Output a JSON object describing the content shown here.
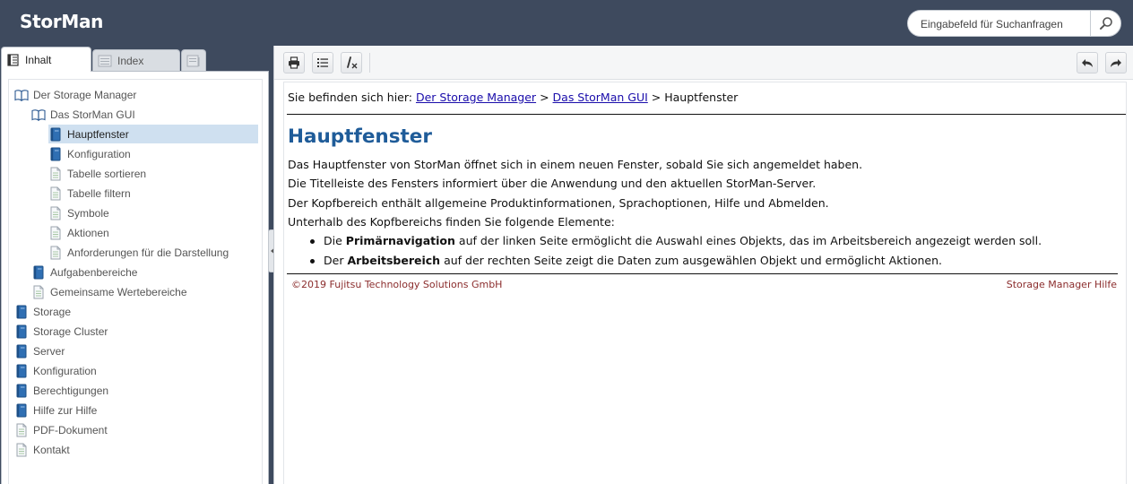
{
  "app": {
    "logo_text": "StorMan"
  },
  "search": {
    "placeholder": "Eingabefeld für Suchanfragen",
    "button_icon": "search-icon"
  },
  "tabs": [
    {
      "label": "Inhalt",
      "icon": "contents-icon",
      "active": true
    },
    {
      "label": "Index",
      "icon": "index-icon",
      "active": false
    },
    {
      "label": "",
      "icon": "glossary-icon",
      "active": false
    }
  ],
  "tree": [
    {
      "label": "Der Storage Manager",
      "icon": "open-book-icon",
      "level": 0
    },
    {
      "label": "Das StorMan GUI",
      "icon": "open-book-icon",
      "level": 1
    },
    {
      "label": "Hauptfenster",
      "icon": "closed-book-icon",
      "level": 2,
      "selected": true
    },
    {
      "label": "Konfiguration",
      "icon": "closed-book-icon",
      "level": 2
    },
    {
      "label": "Tabelle sortieren",
      "icon": "page-icon",
      "level": 2
    },
    {
      "label": "Tabelle filtern",
      "icon": "page-icon",
      "level": 2
    },
    {
      "label": "Symbole",
      "icon": "page-icon",
      "level": 2
    },
    {
      "label": "Aktionen",
      "icon": "page-icon",
      "level": 2
    },
    {
      "label": "Anforderungen für die Darstellung",
      "icon": "page-icon",
      "level": 2
    },
    {
      "label": "Aufgabenbereiche",
      "icon": "closed-book-icon",
      "level": 1
    },
    {
      "label": "Gemeinsame Wertebereiche",
      "icon": "page-icon",
      "level": 1
    },
    {
      "label": "Storage",
      "icon": "closed-book-icon",
      "level": 0
    },
    {
      "label": "Storage Cluster",
      "icon": "closed-book-icon",
      "level": 0
    },
    {
      "label": "Server",
      "icon": "closed-book-icon",
      "level": 0
    },
    {
      "label": "Konfiguration",
      "icon": "closed-book-icon",
      "level": 0
    },
    {
      "label": "Berechtigungen",
      "icon": "closed-book-icon",
      "level": 0
    },
    {
      "label": "Hilfe zur Hilfe",
      "icon": "closed-book-icon",
      "level": 0
    },
    {
      "label": "PDF-Dokument",
      "icon": "page-icon",
      "level": 0
    },
    {
      "label": "Kontakt",
      "icon": "page-icon",
      "level": 0
    }
  ],
  "toolbar": {
    "left_buttons": [
      "print-icon",
      "toggle-list-icon",
      "remove-highlight-icon"
    ],
    "right_buttons": [
      "back-arrow-icon",
      "forward-arrow-icon"
    ]
  },
  "content": {
    "breadcrumb": {
      "prefix": "Sie befinden sich hier:",
      "link1": "Der Storage Manager",
      "sep1": ">",
      "link2": "Das StorMan GUI",
      "sep2": ">",
      "current": "Hauptfenster"
    },
    "title": "Hauptfenster",
    "paragraphs": [
      "Das Hauptfenster von StorMan öffnet sich in einem neuen Fenster, sobald Sie sich angemeldet haben.",
      "Die Titelleiste des Fensters informiert über die Anwendung und den aktuellen StorMan-Server.",
      "Der Kopfbereich enthält allgemeine Produktinformationen, Sprachoptionen, Hilfe und Abmelden.",
      "Unterhalb des Kopfbereichs finden Sie folgende Elemente:"
    ],
    "bullets": [
      {
        "pre": "Die",
        "bold": "Primärnavigation",
        "post": "auf der linken Seite ermöglicht die Auswahl eines Objekts, das im Arbeitsbereich angezeigt werden soll."
      },
      {
        "pre": "Der",
        "bold": "Arbeitsbereich",
        "post": "auf der rechten Seite zeigt die Daten zum ausgewählen Objekt und ermöglicht Aktionen."
      }
    ],
    "footer_left": "©2019 Fujitsu Technology Solutions GmbH",
    "footer_right": "Storage Manager Hilfe"
  },
  "colors": {
    "header_bg": "#3e4a5e",
    "title_blue": "#1f5c99",
    "link_blue": "#1a0dab",
    "footer_red": "#8b2d2d",
    "selected_bg": "#cfe0f0"
  }
}
